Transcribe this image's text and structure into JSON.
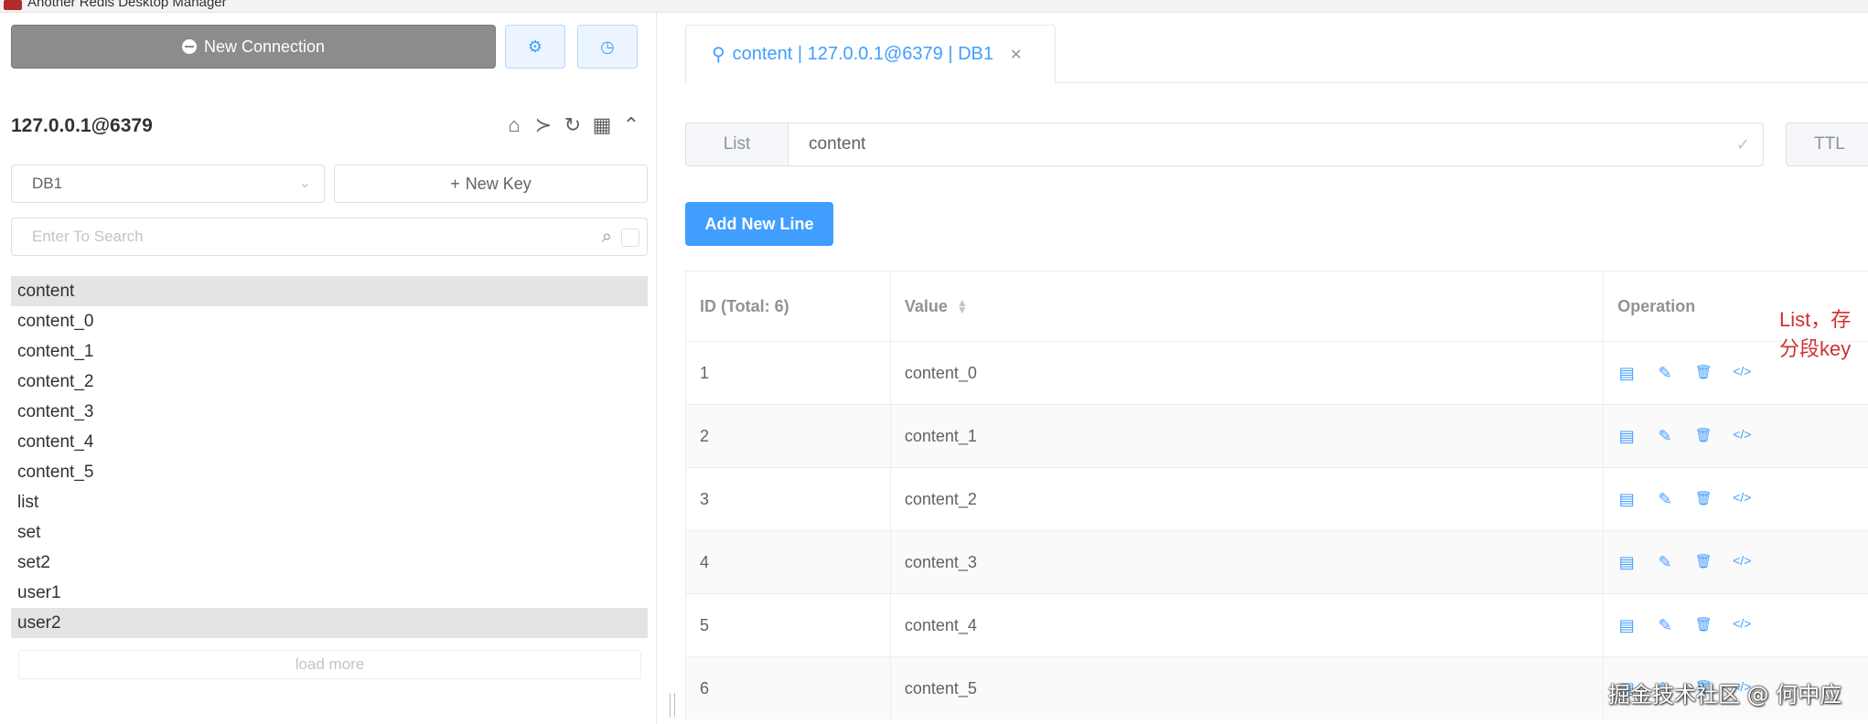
{
  "window": {
    "title": "Another Redis Desktop Manager"
  },
  "sidebar": {
    "new_connection_label": "New Connection",
    "connection_name": "127.0.0.1@6379",
    "db_selected": "DB1",
    "new_key_label": "New Key",
    "search_placeholder": "Enter To Search",
    "keys": [
      "content",
      "content_0",
      "content_1",
      "content_2",
      "content_3",
      "content_4",
      "content_5",
      "list",
      "set",
      "set2",
      "user1",
      "user2"
    ],
    "selected_keys": [
      "content",
      "user2"
    ],
    "load_more_label": "load more"
  },
  "main": {
    "tab_label": "content | 127.0.0.1@6379 | DB1",
    "key_type": "List",
    "key_name": "content",
    "ttl_label": "TTL",
    "add_line_label": "Add New Line",
    "table": {
      "col_id": "ID (Total: 6)",
      "col_value": "Value",
      "col_operation": "Operation",
      "rows": [
        {
          "id": "1",
          "value": "content_0"
        },
        {
          "id": "2",
          "value": "content_1"
        },
        {
          "id": "3",
          "value": "content_2"
        },
        {
          "id": "4",
          "value": "content_3"
        },
        {
          "id": "5",
          "value": "content_4"
        },
        {
          "id": "6",
          "value": "content_5"
        }
      ]
    },
    "annotation": "List，存分段key"
  },
  "watermark": "掘金技术社区 @ 何中应",
  "colors": {
    "primary": "#409eff",
    "sidebar_button": "#8c8c8c",
    "annotation": "#d32f2f"
  }
}
